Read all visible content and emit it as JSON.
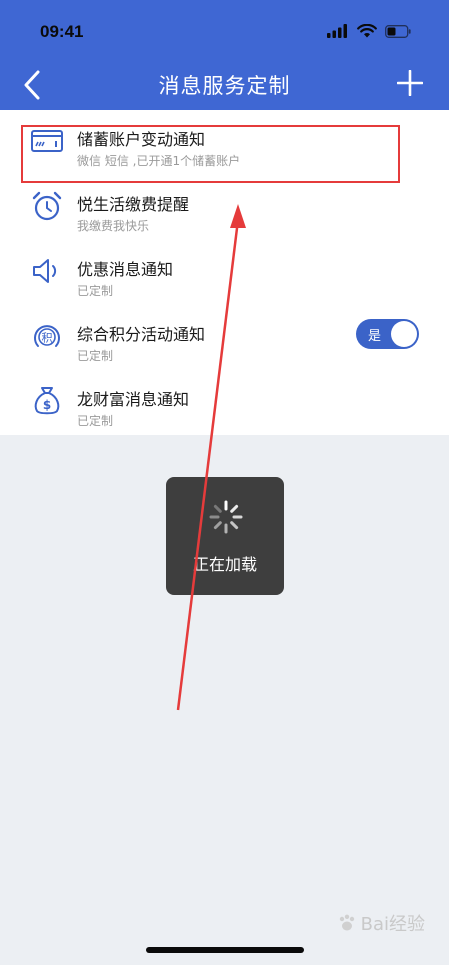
{
  "status_bar": {
    "time": "09:41"
  },
  "nav": {
    "title": "消息服务定制"
  },
  "items": [
    {
      "title": "储蓄账户变动通知",
      "subtitle": "微信 短信 ,已开通1个储蓄账户",
      "icon": "card-icon"
    },
    {
      "title": "悦生活缴费提醒",
      "subtitle": "我缴费我快乐",
      "icon": "alarm-clock-icon"
    },
    {
      "title": "优惠消息通知",
      "subtitle": "已定制",
      "icon": "speaker-icon"
    },
    {
      "title": "综合积分活动通知",
      "subtitle": "已定制",
      "icon": "points-badge-icon"
    },
    {
      "title": "龙财富消息通知",
      "subtitle": "已定制",
      "icon": "money-bag-icon"
    }
  ],
  "toggle": {
    "label": "是",
    "state": "on"
  },
  "points_badge_char": "积",
  "loading": {
    "text": "正在加载"
  },
  "watermark": {
    "text": "Bai经验"
  },
  "colors": {
    "header": "#3f67d3",
    "accent": "#3b63c8",
    "highlight": "#e53b3b",
    "gray_bg": "#eceff3",
    "toast_bg": "#3e3e3e"
  }
}
